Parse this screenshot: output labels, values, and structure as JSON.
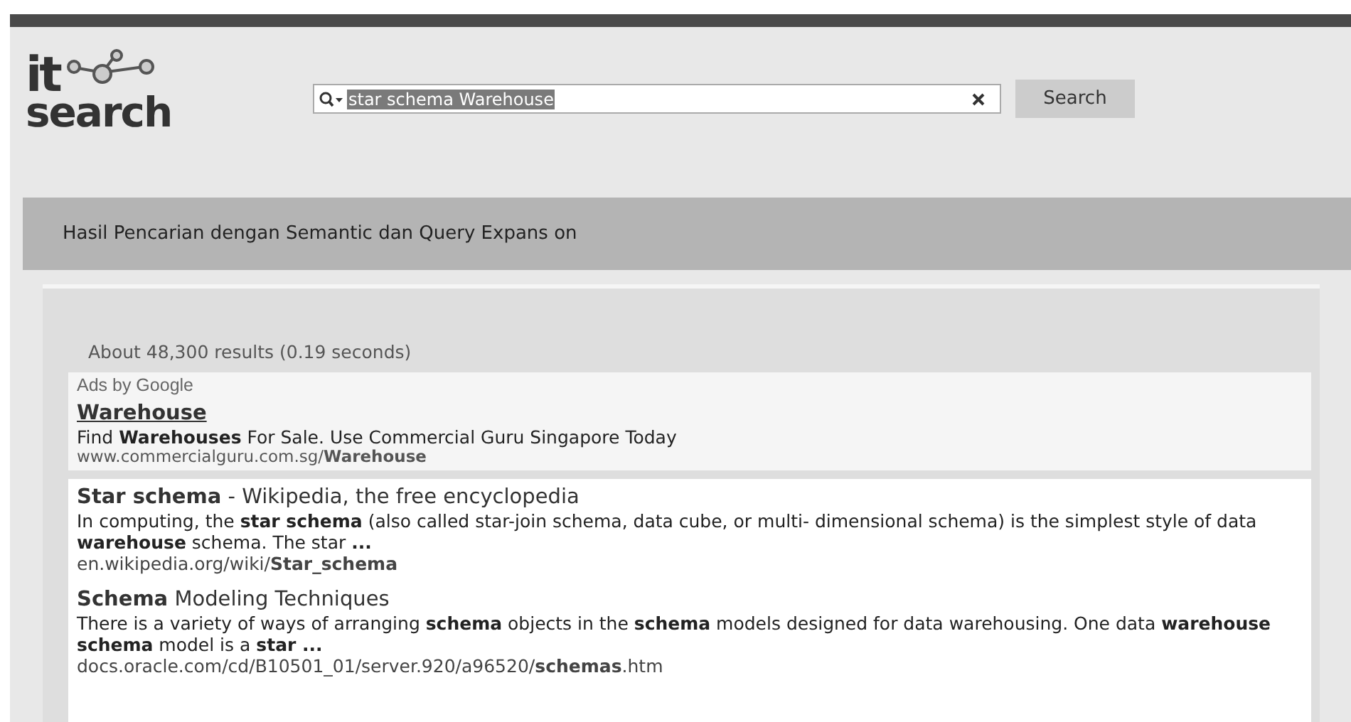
{
  "logo": {
    "top": "it",
    "bottom": "search"
  },
  "search": {
    "value": "star schema Warehouse",
    "button": "Search"
  },
  "banner": "Hasil Pencarian dengan Semantic dan Query Expans on",
  "stats": "About 48,300 results (0.19 seconds)",
  "ads": {
    "label": "Ads by Google",
    "title": "Warehouse",
    "snippet": "Find **Warehouses** For Sale. Use Commercial Guru Singapore Today",
    "url": "www.commercialguru.com.sg/**Warehouse**"
  },
  "results": [
    {
      "title": "**Star schema** - Wikipedia, the free encyclopedia",
      "snippet": "In computing, the **star schema** (also called star-join schema, data cube, or multi- dimensional schema) is the simplest style of data **warehouse** schema. The star **...**",
      "url": "en.wikipedia.org/wiki/**Star_schema**"
    },
    {
      "title": "**Schema** Modeling Techniques",
      "snippet": "There is a variety of ways of arranging **schema** objects in the **schema** models designed for data warehousing. One data **warehouse schema** model is a **star ...**",
      "url": "docs.oracle.com/cd/B10501_01/server.920/a96520/**schemas**.htm"
    }
  ]
}
